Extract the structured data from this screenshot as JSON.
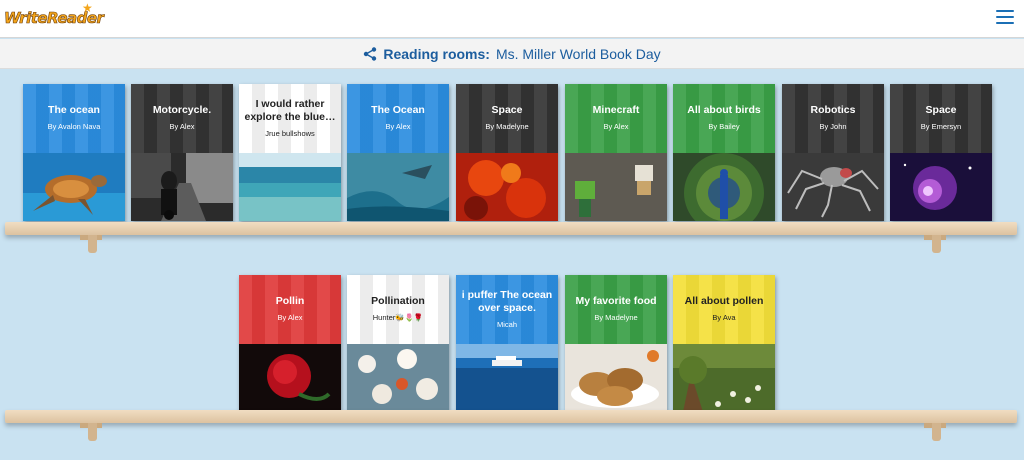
{
  "header": {
    "logo_text": "WriteReader",
    "logo_icon": "star-icon",
    "menu_icon": "hamburger-menu-icon"
  },
  "subheader": {
    "icon": "share-icon",
    "label": "Reading rooms:",
    "room_name": "Ms. Miller World Book Day"
  },
  "shelves": [
    {
      "books": [
        {
          "title": "The ocean",
          "author": "By Avalon Nava",
          "color": "blue",
          "picture": "sea-turtle"
        },
        {
          "title": "Motorcycle.",
          "author": "By Alex",
          "color": "dark",
          "picture": "motorcycle"
        },
        {
          "title": "I would rather explore the blue…",
          "author": "Jrue bullshows",
          "color": "white",
          "picture": "shallow-sea"
        },
        {
          "title": "The Ocean",
          "author": "By Alex",
          "color": "blue",
          "picture": "shark-wave"
        },
        {
          "title": "Space",
          "author": "By Madelyne",
          "color": "dark",
          "picture": "fire-nebula"
        },
        {
          "title": "Minecraft",
          "author": "By Alex",
          "color": "green",
          "picture": "minecraft-figures"
        },
        {
          "title": "All about birds",
          "author": "By Bailey",
          "color": "green",
          "picture": "peacock"
        },
        {
          "title": "Robotics",
          "author": "By John",
          "color": "dark",
          "picture": "robot-spider"
        },
        {
          "title": "Space",
          "author": "By Emersyn",
          "color": "dark",
          "picture": "purple-nebula"
        }
      ]
    },
    {
      "books": [
        {
          "title": "Pollin",
          "author": "By Alex",
          "color": "red",
          "picture": "red-rose"
        },
        {
          "title": "Pollination",
          "author": "Hunter🐝🌷🌹",
          "color": "white",
          "picture": "white-blossoms"
        },
        {
          "title": "i puffer The ocean over space.",
          "author": "Micah",
          "color": "blue",
          "picture": "cruise-ship"
        },
        {
          "title": "My favorite food",
          "author": "By Madelyne",
          "color": "green",
          "picture": "cookies"
        },
        {
          "title": "All about pollen",
          "author": "By Ava",
          "color": "yellow",
          "picture": "flower-field"
        }
      ]
    }
  ]
}
